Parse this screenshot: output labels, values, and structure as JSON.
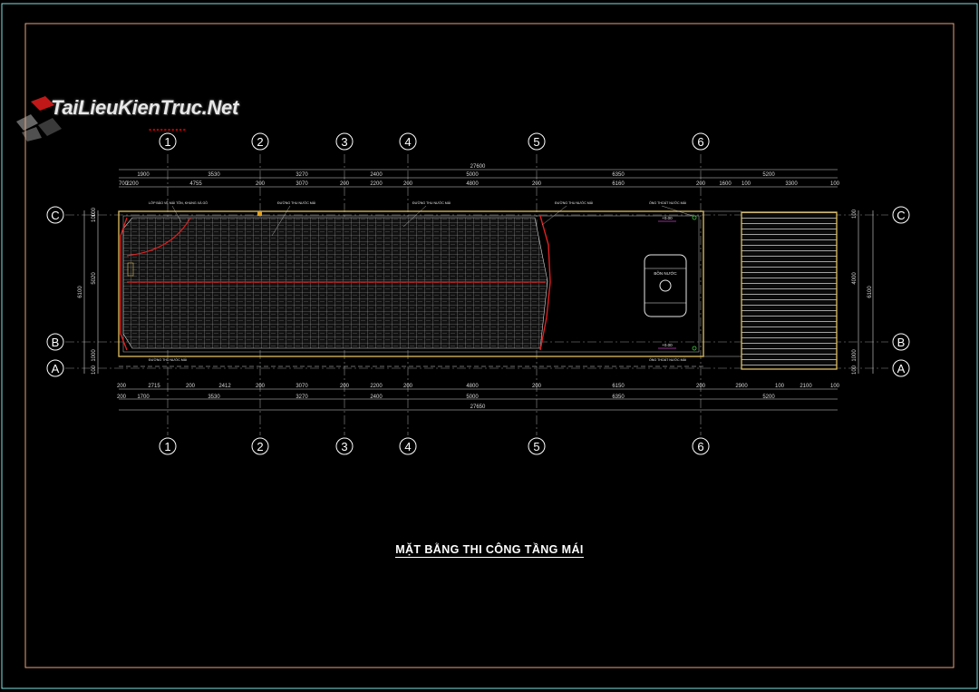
{
  "logo": {
    "text": "TaiLieuKienTruc.Net",
    "icon": "logo-cube-icon"
  },
  "title": "MẶT BẰNG THI CÔNG TẦNG MÁI",
  "grid": {
    "columns": [
      "1",
      "2",
      "3",
      "4",
      "5",
      "6"
    ],
    "rows": [
      "C",
      "B",
      "A"
    ]
  },
  "dimensions": {
    "top_total": "27600",
    "top_row1": [
      "1900",
      "3530",
      "3270",
      "2400",
      "5000",
      "6350",
      "5200"
    ],
    "top_row2": [
      "700",
      "2200",
      "4755",
      "200",
      "3070",
      "200",
      "2200",
      "200",
      "4800",
      "200",
      "6160",
      "200",
      "1600",
      "100",
      "3300",
      "100"
    ],
    "bottom_row1": [
      "200",
      "2715",
      "200",
      "2412",
      "200",
      "3070",
      "200",
      "2200",
      "200",
      "4800",
      "200",
      "6150",
      "200",
      "2900",
      "100",
      "2100",
      "100"
    ],
    "bottom_row2": [
      "200",
      "1700",
      "3530",
      "3270",
      "2400",
      "5000",
      "6350",
      "5200"
    ],
    "bottom_total": "27650",
    "left_outer": "6100",
    "left_inner": [
      "100",
      "100",
      "5020",
      "1000",
      "100"
    ],
    "right_outer": "6100",
    "right_inner": [
      "100",
      "4000",
      "1000",
      "100"
    ]
  },
  "notes": {
    "n1": "LỚP BẢO VỆ MÁI TÔN, KHUNG XÀ GỒ",
    "n2": "ĐƯỜNG THU NƯỚC MÁI",
    "n3": "ĐƯỜNG THU NƯỚC MÁI",
    "n4": "ĐƯỜNG THU NƯỚC MÁI",
    "n5": "ỐNG THOÁT NƯỚC MÁI",
    "n6": "ỐNG THOÁT NƯỚC MÁI",
    "n7": "ĐƯỜNG THU NƯỚC MÁI",
    "tank": "BỒN NƯỚC",
    "level1": "+0.00",
    "level2": "+0.00"
  },
  "colors": {
    "frame": "#7fe0e0",
    "border": "#e7a27a",
    "roof_edge": "#e0c060",
    "tile": "#b8b8b8",
    "red": "#e02020",
    "dim": "#d8d8d8",
    "axis": "#ffffff"
  }
}
